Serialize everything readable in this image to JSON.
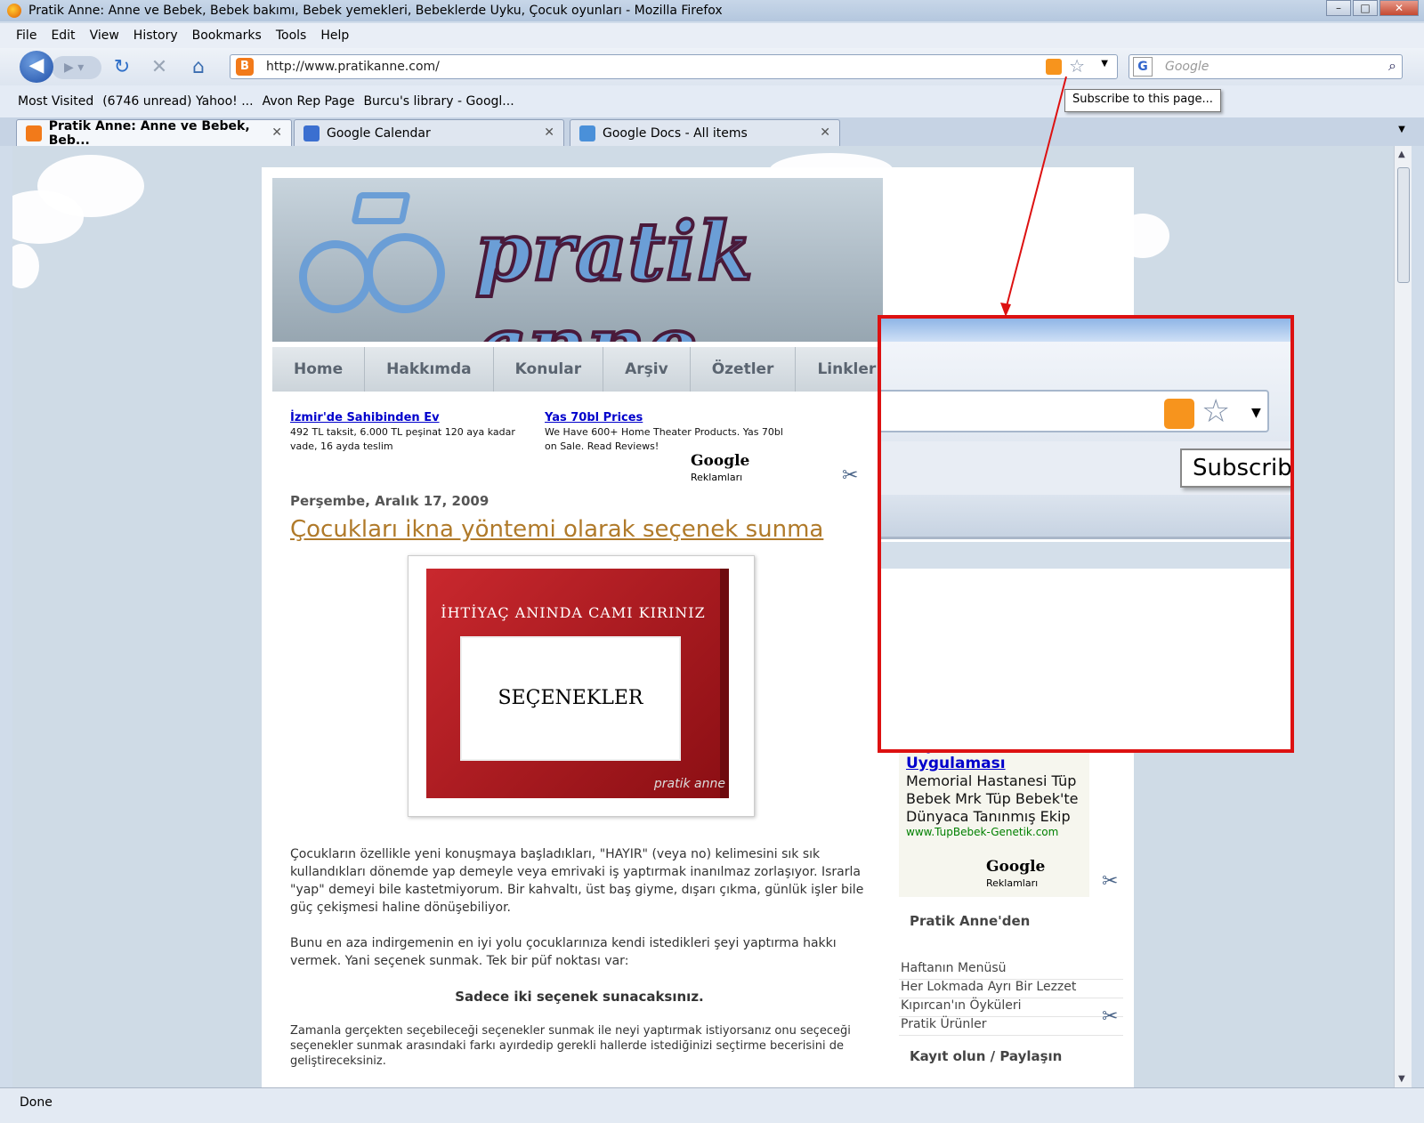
{
  "window": {
    "title": "Pratik Anne: Anne ve Bebek, Bebek bakımı, Bebek yemekleri, Bebeklerde Uyku, Çocuk oyunları - Mozilla Firefox"
  },
  "menu": [
    "File",
    "Edit",
    "View",
    "History",
    "Bookmarks",
    "Tools",
    "Help"
  ],
  "nav": {
    "url": "http://www.pratikanne.com/",
    "search_placeholder": "Google"
  },
  "bookmarks": [
    "Most Visited",
    "(6746 unread) Yahoo! ...",
    "Avon Rep Page",
    "Burcu's library - Googl..."
  ],
  "tooltip": "Subscribe to this page...",
  "tabs": [
    {
      "label": "Pratik Anne: Anne ve Bebek, Beb...",
      "active": true
    },
    {
      "label": "Google Calendar",
      "active": false
    },
    {
      "label": "Google Docs - All items",
      "active": false
    }
  ],
  "site": {
    "logo": "pratik anne",
    "nav_items": [
      "Home",
      "Hakkımda",
      "Konular",
      "Arşiv",
      "Özetler",
      "Linkler"
    ],
    "ads": [
      {
        "title": "İzmir'de Sahibinden Ev",
        "text": "492 TL taksit, 6.000 TL peşinat 120 aya kadar vade, 16 ayda teslim"
      },
      {
        "title": "Yas 70bl Prices",
        "text": "We Have 600+ Home Theater Products. Yas 70bl on Sale. Read Reviews!"
      }
    ],
    "google_ads_label": "Google",
    "google_ads_suffix": "Reklamları",
    "post": {
      "date": "Perşembe, Aralık 17, 2009",
      "title": "Çocukları ikna yöntemi olarak seçenek sunma",
      "image_caption_top": "İHTİYAÇ ANINDA CAMI KIRINIZ",
      "image_caption_box": "SEÇENEKLER",
      "image_watermark": "pratik anne",
      "para1": "Çocukların özellikle yeni konuşmaya başladıkları, \"HAYIR\" (veya no) kelimesini sık sık kullandıkları dönemde yap demeyle veya emrivaki iş yaptırmak inanılmaz zorlaşıyor. Israrla \"yap\" demeyi bile kastetmiyorum. Bir kahvaltı, üst baş giyme, dışarı çıkma, günlük işler bile güç çekişmesi haline dönüşebiliyor.",
      "para2": "Bunu en aza indirgemenin en iyi yolu çocuklarınıza kendi istedikleri şeyi yaptırma hakkı vermek. Yani seçenek sunmak. Tek bir püf noktası var:",
      "emphasis": "Sadece iki seçenek sunacaksınız.",
      "para3": "Zamanla gerçekten seçebileceği seçenekler sunmak ile neyi yaptırmak istiyorsanız onu seçeceği seçenekler sunmak arasındaki farkı ayırdedip gerekli hallerde istediğinizi seçtirme becerisini de geliştireceksiniz."
    },
    "sidebar_ad": {
      "title": "Tüp Bebek Uygulaması",
      "text": "Memorial Hastanesi Tüp Bebek Mrk Tüp Bebek'te Dünyaca Tanınmış Ekip",
      "url": "www.TupBebek-Genetik.com"
    },
    "sidebar_section1": "Pratik Anne'den",
    "sidebar_links": [
      "Haftanın Menüsü",
      "Her Lokmada Ayrı Bir Lezzet",
      "Kıpırcan'ın Öyküleri",
      "Pratik Ürünler"
    ],
    "sidebar_section2": "Kayıt olun / Paylaşın"
  },
  "zoom_callout": {
    "tooltip_text": "Subscribe"
  },
  "status": "Done",
  "colors": {
    "annotation_red": "#dd1111",
    "rss_orange": "#f7941d",
    "title_link": "#b07a2a"
  }
}
